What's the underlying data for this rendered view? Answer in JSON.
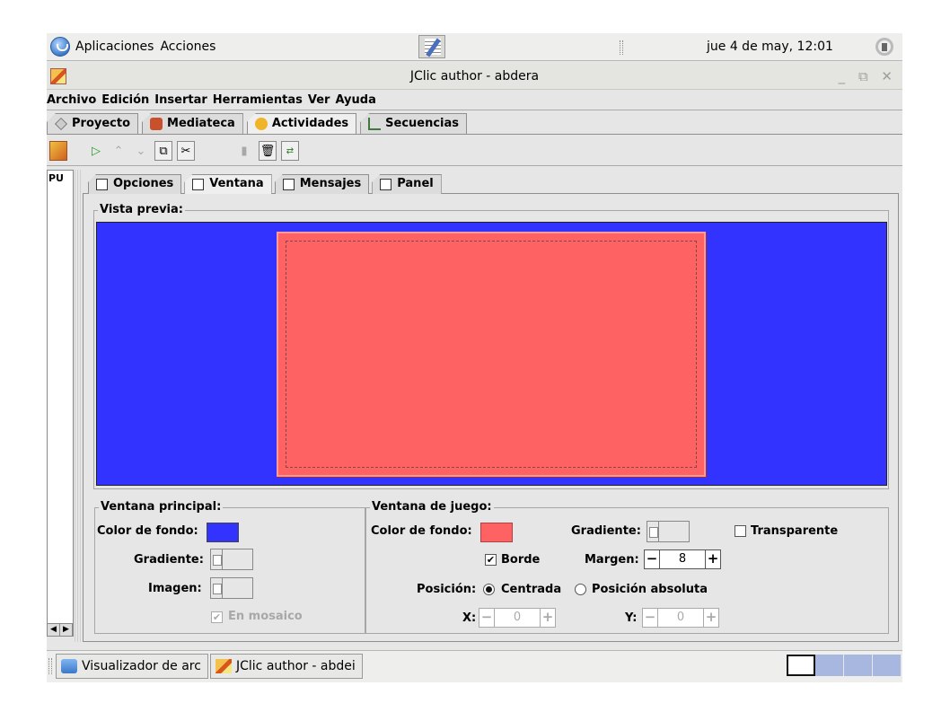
{
  "top_panel": {
    "applications": "Aplicaciones",
    "actions": "Acciones",
    "clock": "jue  4 de may, 12:01",
    "icons": [
      "gnome-foot-icon",
      "note-editor-icon",
      "volume-icon"
    ]
  },
  "window": {
    "title": "JClic author - abdera",
    "controls": "_ ⧉ ✕"
  },
  "menubar": {
    "items": [
      "Archivo",
      "Edición",
      "Insertar",
      "Herramientas",
      "Ver",
      "Ayuda"
    ]
  },
  "main_tabs": [
    "Proyecto",
    "Mediateca",
    "Actividades",
    "Secuencias"
  ],
  "main_tabs_active": "Actividades",
  "toolbar": {
    "icons": [
      "new-activity-icon",
      "play-icon",
      "move-up-icon",
      "move-down-icon",
      "copy-icon",
      "cut-icon",
      "paste-icon",
      "delete-icon",
      "resize-icon"
    ]
  },
  "activity_list": {
    "items": [
      "PU"
    ],
    "scroll_left": "◀",
    "scroll_right": "▶"
  },
  "inner_tabs": [
    "Opciones",
    "Ventana",
    "Mensajes",
    "Panel"
  ],
  "inner_tabs_active": "Ventana",
  "preview": {
    "title": "Vista previa:",
    "background_color": "#3333ff",
    "window_color": "#ff6262"
  },
  "main_window": {
    "title": "Ventana principal:",
    "bg_color_label": "Color de fondo:",
    "bg_color": "#3333ff",
    "gradient_label": "Gradiente:",
    "image_label": "Imagen:",
    "mosaic_label": "En mosaico",
    "mosaic_checked": true
  },
  "game_window": {
    "title": "Ventana de juego:",
    "bg_color_label": "Color de fondo:",
    "bg_color": "#ff6262",
    "gradient_label": "Gradiente:",
    "transparent_label": "Transparente",
    "transparent_checked": false,
    "border_label": "Borde",
    "border_checked": true,
    "margin_label": "Margen:",
    "margin_value": "8",
    "position_label": "Posición:",
    "position_centered": "Centrada",
    "position_absolute": "Posición absoluta",
    "x_label": "X:",
    "x_value": "0",
    "y_label": "Y:",
    "y_value": "0",
    "minus": "−",
    "plus": "+"
  },
  "taskbar": {
    "items": [
      "Visualizador de arc",
      "JClic author - abdei"
    ]
  }
}
